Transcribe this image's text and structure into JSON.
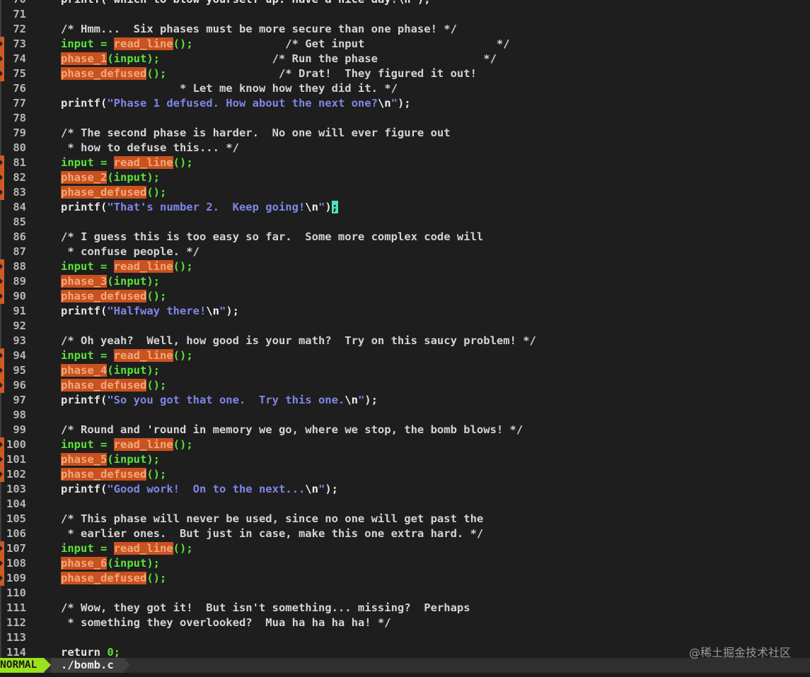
{
  "editor": {
    "lines": [
      {
        "num": "70",
        "marked": false,
        "tokens": [
          {
            "t": "printf(\"which to blow yourself up. Have a nice day!\\n\");",
            "c": "tok-plain"
          }
        ]
      },
      {
        "num": "71",
        "marked": false,
        "tokens": []
      },
      {
        "num": "72",
        "marked": false,
        "tokens": [
          {
            "t": "/* Hmm...  Six phases must be more secure than one phase! */",
            "c": "tok-comment"
          }
        ]
      },
      {
        "num": "73",
        "marked": true,
        "tokens": [
          {
            "t": "input = ",
            "c": "tok-var"
          },
          {
            "t": "read_line",
            "c": "tok-hl"
          },
          {
            "t": "();",
            "c": "tok-punct"
          },
          {
            "t": "              /* Get input                    */",
            "c": "tok-comment"
          }
        ]
      },
      {
        "num": "74",
        "marked": true,
        "tokens": [
          {
            "t": "phase_1",
            "c": "tok-hl"
          },
          {
            "t": "(input);",
            "c": "tok-var"
          },
          {
            "t": "                 /* Run the phase                */",
            "c": "tok-comment"
          }
        ]
      },
      {
        "num": "75",
        "marked": true,
        "tokens": [
          {
            "t": "phase_defused",
            "c": "tok-hl"
          },
          {
            "t": "();",
            "c": "tok-punct"
          },
          {
            "t": "                 /* Drat!  They figured it out!",
            "c": "tok-comment"
          }
        ]
      },
      {
        "num": "76",
        "marked": false,
        "tokens": [
          {
            "t": "                  * Let me know how they did it. */",
            "c": "tok-comment"
          }
        ]
      },
      {
        "num": "77",
        "marked": false,
        "tokens": [
          {
            "t": "printf(",
            "c": "tok-plain"
          },
          {
            "t": "\"Phase 1 defused. How about the next one?",
            "c": "tok-string"
          },
          {
            "t": "\\n",
            "c": "tok-escape"
          },
          {
            "t": "\"",
            "c": "tok-string"
          },
          {
            "t": ");",
            "c": "tok-plain"
          }
        ]
      },
      {
        "num": "78",
        "marked": false,
        "tokens": []
      },
      {
        "num": "79",
        "marked": false,
        "tokens": [
          {
            "t": "/* The second phase is harder.  No one will ever figure out",
            "c": "tok-comment"
          }
        ]
      },
      {
        "num": "80",
        "marked": false,
        "tokens": [
          {
            "t": " * how to defuse this... */",
            "c": "tok-comment"
          }
        ]
      },
      {
        "num": "81",
        "marked": true,
        "tokens": [
          {
            "t": "input = ",
            "c": "tok-var"
          },
          {
            "t": "read_line",
            "c": "tok-hl"
          },
          {
            "t": "();",
            "c": "tok-punct"
          }
        ]
      },
      {
        "num": "82",
        "marked": true,
        "tokens": [
          {
            "t": "phase_2",
            "c": "tok-hl"
          },
          {
            "t": "(input);",
            "c": "tok-var"
          }
        ]
      },
      {
        "num": "83",
        "marked": true,
        "tokens": [
          {
            "t": "phase_defused",
            "c": "tok-hl"
          },
          {
            "t": "();",
            "c": "tok-punct"
          }
        ]
      },
      {
        "num": "84",
        "marked": false,
        "tokens": [
          {
            "t": "printf(",
            "c": "tok-plain"
          },
          {
            "t": "\"That's number 2.  Keep going!",
            "c": "tok-string"
          },
          {
            "t": "\\n",
            "c": "tok-escape"
          },
          {
            "t": "\"",
            "c": "tok-string"
          },
          {
            "t": ")",
            "c": "tok-plain"
          },
          {
            "t": ";",
            "c": "cursor"
          }
        ]
      },
      {
        "num": "85",
        "marked": false,
        "tokens": []
      },
      {
        "num": "86",
        "marked": false,
        "tokens": [
          {
            "t": "/* I guess this is too easy so far.  Some more complex code will",
            "c": "tok-comment"
          }
        ]
      },
      {
        "num": "87",
        "marked": false,
        "tokens": [
          {
            "t": " * confuse people. */",
            "c": "tok-comment"
          }
        ]
      },
      {
        "num": "88",
        "marked": true,
        "tokens": [
          {
            "t": "input = ",
            "c": "tok-var"
          },
          {
            "t": "read_line",
            "c": "tok-hl"
          },
          {
            "t": "();",
            "c": "tok-punct"
          }
        ]
      },
      {
        "num": "89",
        "marked": true,
        "tokens": [
          {
            "t": "phase_3",
            "c": "tok-hl"
          },
          {
            "t": "(input);",
            "c": "tok-var"
          }
        ]
      },
      {
        "num": "90",
        "marked": true,
        "tokens": [
          {
            "t": "phase_defused",
            "c": "tok-hl"
          },
          {
            "t": "();",
            "c": "tok-punct"
          }
        ]
      },
      {
        "num": "91",
        "marked": false,
        "tokens": [
          {
            "t": "printf(",
            "c": "tok-plain"
          },
          {
            "t": "\"Halfway there!",
            "c": "tok-string"
          },
          {
            "t": "\\n",
            "c": "tok-escape"
          },
          {
            "t": "\"",
            "c": "tok-string"
          },
          {
            "t": ");",
            "c": "tok-plain"
          }
        ]
      },
      {
        "num": "92",
        "marked": false,
        "tokens": []
      },
      {
        "num": "93",
        "marked": false,
        "tokens": [
          {
            "t": "/* Oh yeah?  Well, how good is your math?  Try on this saucy problem! */",
            "c": "tok-comment"
          }
        ]
      },
      {
        "num": "94",
        "marked": true,
        "tokens": [
          {
            "t": "input = ",
            "c": "tok-var"
          },
          {
            "t": "read_line",
            "c": "tok-hl"
          },
          {
            "t": "();",
            "c": "tok-punct"
          }
        ]
      },
      {
        "num": "95",
        "marked": true,
        "tokens": [
          {
            "t": "phase_4",
            "c": "tok-hl"
          },
          {
            "t": "(input);",
            "c": "tok-var"
          }
        ]
      },
      {
        "num": "96",
        "marked": true,
        "tokens": [
          {
            "t": "phase_defused",
            "c": "tok-hl"
          },
          {
            "t": "();",
            "c": "tok-punct"
          }
        ]
      },
      {
        "num": "97",
        "marked": false,
        "tokens": [
          {
            "t": "printf(",
            "c": "tok-plain"
          },
          {
            "t": "\"So you got that one.  Try this one.",
            "c": "tok-string"
          },
          {
            "t": "\\n",
            "c": "tok-escape"
          },
          {
            "t": "\"",
            "c": "tok-string"
          },
          {
            "t": ");",
            "c": "tok-plain"
          }
        ]
      },
      {
        "num": "98",
        "marked": false,
        "tokens": []
      },
      {
        "num": "99",
        "marked": false,
        "tokens": [
          {
            "t": "/* Round and 'round in memory we go, where we stop, the bomb blows! */",
            "c": "tok-comment"
          }
        ]
      },
      {
        "num": "100",
        "marked": true,
        "tokens": [
          {
            "t": "input = ",
            "c": "tok-var"
          },
          {
            "t": "read_line",
            "c": "tok-hl"
          },
          {
            "t": "();",
            "c": "tok-punct"
          }
        ]
      },
      {
        "num": "101",
        "marked": true,
        "tokens": [
          {
            "t": "phase_5",
            "c": "tok-hl"
          },
          {
            "t": "(input);",
            "c": "tok-var"
          }
        ]
      },
      {
        "num": "102",
        "marked": true,
        "tokens": [
          {
            "t": "phase_defused",
            "c": "tok-hl"
          },
          {
            "t": "();",
            "c": "tok-punct"
          }
        ]
      },
      {
        "num": "103",
        "marked": false,
        "tokens": [
          {
            "t": "printf(",
            "c": "tok-plain"
          },
          {
            "t": "\"Good work!  On to the next...",
            "c": "tok-string"
          },
          {
            "t": "\\n",
            "c": "tok-escape"
          },
          {
            "t": "\"",
            "c": "tok-string"
          },
          {
            "t": ");",
            "c": "tok-plain"
          }
        ]
      },
      {
        "num": "104",
        "marked": false,
        "tokens": []
      },
      {
        "num": "105",
        "marked": false,
        "tokens": [
          {
            "t": "/* This phase will never be used, since no one will get past the",
            "c": "tok-comment"
          }
        ]
      },
      {
        "num": "106",
        "marked": false,
        "tokens": [
          {
            "t": " * earlier ones.  But just in case, make this one extra hard. */",
            "c": "tok-comment"
          }
        ]
      },
      {
        "num": "107",
        "marked": true,
        "tokens": [
          {
            "t": "input = ",
            "c": "tok-var"
          },
          {
            "t": "read_line",
            "c": "tok-hl"
          },
          {
            "t": "();",
            "c": "tok-punct"
          }
        ]
      },
      {
        "num": "108",
        "marked": true,
        "tokens": [
          {
            "t": "phase_6",
            "c": "tok-hl"
          },
          {
            "t": "(input);",
            "c": "tok-var"
          }
        ]
      },
      {
        "num": "109",
        "marked": true,
        "tokens": [
          {
            "t": "phase_defused",
            "c": "tok-hl"
          },
          {
            "t": "();",
            "c": "tok-punct"
          }
        ]
      },
      {
        "num": "110",
        "marked": false,
        "tokens": []
      },
      {
        "num": "111",
        "marked": false,
        "tokens": [
          {
            "t": "/* Wow, they got it!  But isn't something... missing?  Perhaps",
            "c": "tok-comment"
          }
        ]
      },
      {
        "num": "112",
        "marked": false,
        "tokens": [
          {
            "t": " * something they overlooked?  Mua ha ha ha ha! */",
            "c": "tok-comment"
          }
        ]
      },
      {
        "num": "113",
        "marked": false,
        "tokens": []
      },
      {
        "num": "114",
        "marked": false,
        "tokens": [
          {
            "t": "return ",
            "c": "tok-kw"
          },
          {
            "t": "0",
            "c": "tok-num"
          },
          {
            "t": ";",
            "c": "tok-punct"
          }
        ]
      }
    ]
  },
  "statusline": {
    "mode": "NORMAL",
    "filename": "./bomb.c"
  },
  "watermark": "@稀土掘金技术社区",
  "colors": {
    "background": "#1e1e1e",
    "highlight": "#c9521f",
    "mode_bg": "#9be21e",
    "string": "#7f86e8",
    "identifier": "#5ae43a"
  }
}
